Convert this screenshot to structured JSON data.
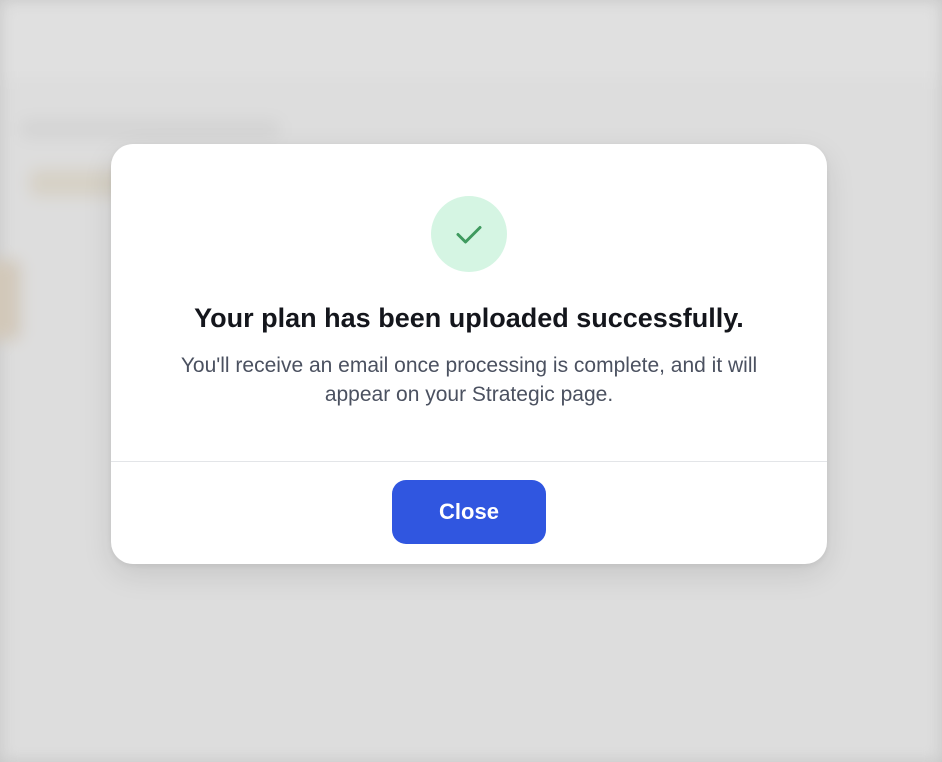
{
  "modal": {
    "icon": "checkmark-icon",
    "title": "Your plan has been uploaded successfully.",
    "message": "You'll receive an email once processing is complete, and it will appear on your Strategic page.",
    "close_label": "Close"
  },
  "colors": {
    "accent": "#3056e0",
    "success_bg": "#d5f5e3",
    "success_icon": "#3f9a5f",
    "title_text": "#14161c",
    "body_text": "#4b5160"
  }
}
